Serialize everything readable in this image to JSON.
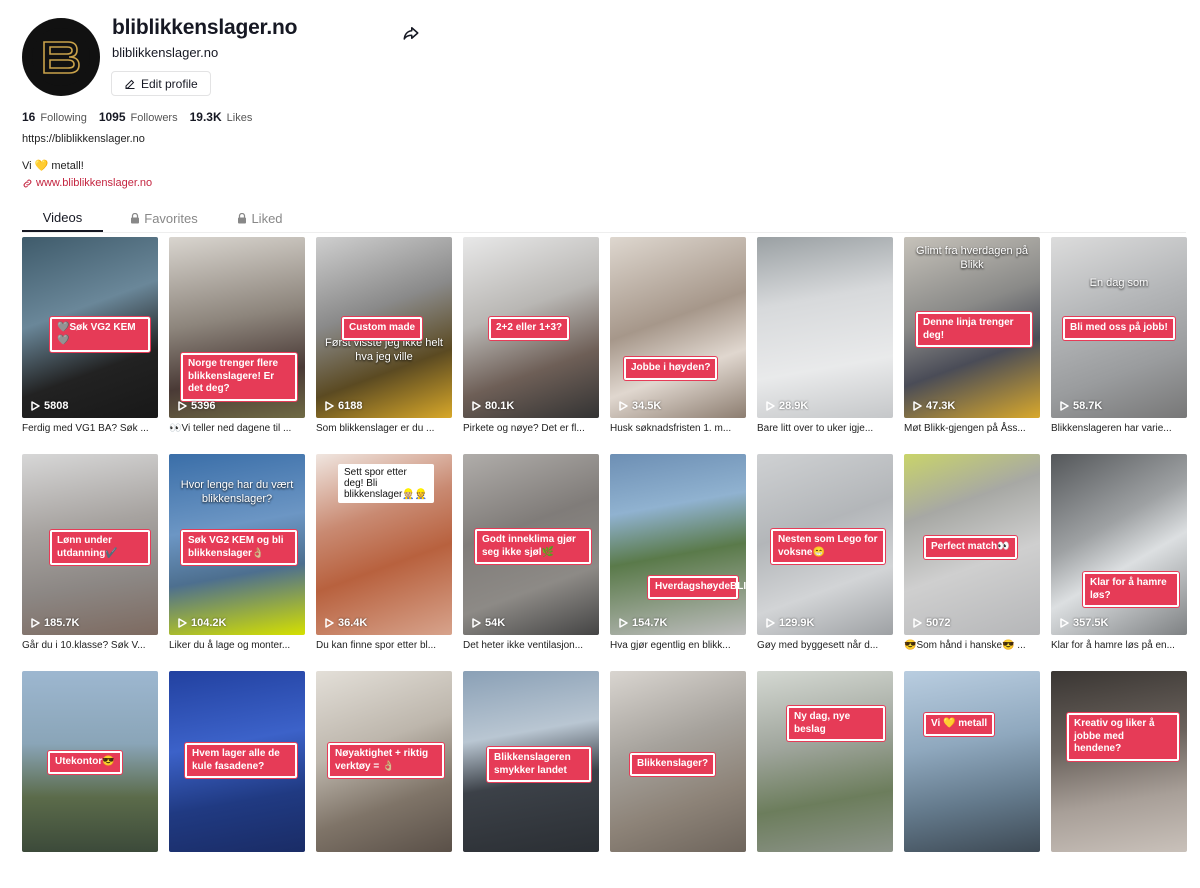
{
  "profile": {
    "username": "bliblikkenslager.no",
    "nickname": "bliblikkenslager.no",
    "edit_label": "Edit profile",
    "following_count": "16",
    "following_label": "Following",
    "followers_count": "1095",
    "followers_label": "Followers",
    "likes_count": "19.3K",
    "likes_label": "Likes",
    "url": "https://bliblikkenslager.no",
    "bio": "Vi 💛 metall!",
    "link": "www.bliblikkenslager.no"
  },
  "tabs": [
    {
      "label": "Videos"
    },
    {
      "label": "Favorites"
    },
    {
      "label": "Liked"
    }
  ],
  "colors": {
    "accent": "#fe2c55",
    "tag": "#e63b57",
    "link": "#c42540"
  },
  "videos": [
    {
      "views": "5808",
      "caption": "Ferdig med VG1 BA? Søk ...",
      "tag": "🩶Søk VG2 KEM🩶",
      "bg": "linear-gradient(160deg,#3f5b6b,#6a8799 40%,#222 70%,#181818)"
    },
    {
      "views": "5396",
      "caption": "👀Vi teller ned dagene til ...",
      "tag": "Norge trenger flere blikkenslagere! Er det deg?",
      "bg": "linear-gradient(170deg,#d9d5cf,#8d857c 45%,#4a3a36 75%,#6f6a44)"
    },
    {
      "views": "6188",
      "caption": "Som blikkenslager er du ...",
      "tag": "Custom made",
      "over": "Først visste jeg ikke helt hva jeg ville",
      "bg": "linear-gradient(160deg,#cfcfcf,#8a8a8a 40%,#5b4a22 70%,#d8a829)"
    },
    {
      "views": "80.1K",
      "caption": "Pirkete og nøye? Det er fl...",
      "tag": "2+2 eller 1+3?",
      "bg": "linear-gradient(160deg,#e8e8e8,#b9b7b4 40%,#6e5f57 70%,#333)"
    },
    {
      "views": "34.5K",
      "caption": "Husk søknadsfristen 1. m...",
      "tag": "Jobbe i høyden?",
      "bg": "linear-gradient(160deg,#ded7cf,#a6978a 45%,#e0d7cf 70%,#8c7d70)"
    },
    {
      "views": "28.9K",
      "caption": "Bare litt over to uker igje...",
      "bg": "linear-gradient(170deg,#9aa0a3,#d7d9db 35%,#e9eaeb 70%,#c5c7c9)"
    },
    {
      "views": "47.3K",
      "caption": "Møt Blikk-gjengen på Åss...",
      "tag": "Denne linja trenger deg!",
      "over": "Glimt fra hverdagen på Blikk",
      "bg": "linear-gradient(160deg,#c6c2ba,#8a8a88 40%,#4a4c57 65%,#d8a82c)"
    },
    {
      "views": "58.7K",
      "caption": "Blikkenslageren har varie...",
      "tag": "Bli med oss på jobb!",
      "over": "En dag som",
      "bg": "linear-gradient(160deg,#dcdcdc,#b4b6b8 40%,#9a9c9e 70%,#777)"
    },
    {
      "views": "185.7K",
      "caption": "Går du i 10.klasse? Søk V...",
      "tag": "Lønn under utdanning✔️",
      "bg": "linear-gradient(170deg,#d7d7d7,#a7a3a0 40%,#8c8784 70%,#7d6a60)"
    },
    {
      "views": "104.2K",
      "caption": "Liker du å lage og monter...",
      "tag": "Søk VG2 KEM og bli blikkenslager👌🏼",
      "over": "Hvor lenge har du vært blikkenslager?",
      "bg": "linear-gradient(170deg,#3a6ea8,#6c96c4 40%,#4d6f8f 65%,#d5e000)"
    },
    {
      "views": "36.4K",
      "caption": "Du kan finne spor etter bl...",
      "white": "Sett spor etter deg! Bli blikkenslager👷🏼👷",
      "bg": "linear-gradient(160deg,#f0e6e0,#c98a72 35%,#b8613e 60%,#d7a38c)"
    },
    {
      "views": "54K",
      "caption": "Det heter ikke ventilasjon...",
      "tag": "Godt inneklima gjør seg ikke sjøl🌿",
      "bg": "linear-gradient(160deg,#b0adaa,#807c79 40%,#8d8a86 70%,#444)"
    },
    {
      "views": "154.7K",
      "caption": "Hva gjør egentlig en blikk...",
      "tag": "HverdagshøydeBLIKK",
      "bg": "linear-gradient(170deg,#6d8fb4,#90b2d0 30%,#5a7a4a 55%,#bcbcbc)"
    },
    {
      "views": "129.9K",
      "caption": "Gøy med byggesett når d...",
      "tag": "Nesten som Lego for voksne😁",
      "bg": "linear-gradient(160deg,#cfd1d3,#b3b6b9 40%,#d2d4d6 70%,#9ea1a4)"
    },
    {
      "views": "5072",
      "caption": "😎Som hånd i hanske😎 ...",
      "tag": "Perfect match👀",
      "bg": "linear-gradient(160deg,#c9d46a,#a7a8a4 30%,#cfcfcf 60%,#b5b6b8)"
    },
    {
      "views": "357.5K",
      "caption": "Klar for å hamre løs på en...",
      "tag": "Klar for å hamre løs?",
      "bg": "linear-gradient(150deg,#54575a,#9ea1a3 40%,#dcdfe1 60%,#7e8183)"
    },
    {
      "views": "",
      "caption": "",
      "tag": "Utekontor😎",
      "bg": "linear-gradient(180deg,#9db7d0,#8aa5b8 40%,#5b6b4a 70%,#3c4a3a)"
    },
    {
      "views": "",
      "caption": "",
      "tag": "Hvem lager alle de kule fasadene?",
      "bg": "linear-gradient(170deg,#2241a0,#3c62c9 40%,#203a82 70%,#1a2c66)"
    },
    {
      "views": "",
      "caption": "",
      "tag": "Nøyaktighet + riktig verktøy = 👌🏼",
      "bg": "linear-gradient(160deg,#e3dfd8,#bdb6ac 40%,#7f7468 70%,#5a5048)"
    },
    {
      "views": "",
      "caption": "",
      "tag": "Blikkenslageren smykker landet",
      "bg": "linear-gradient(170deg,#8aa0b6,#b9c6d2 35%,#3c4148 60%,#2b2f34)"
    },
    {
      "views": "",
      "caption": "",
      "tag": "Blikkenslager?",
      "bg": "linear-gradient(160deg,#d9d5d0,#a6a29c 40%,#8d8378 70%,#6e655c)"
    },
    {
      "views": "",
      "caption": "",
      "tag": "Ny dag, nye beslag",
      "bg": "linear-gradient(170deg,#d4d8d2,#9fa59c 40%,#6c7d5c 70%,#8d948a)"
    },
    {
      "views": "",
      "caption": "",
      "tag": "Vi 💛 metall",
      "bg": "linear-gradient(170deg,#b9cde0,#8fa8be 40%,#647a8c 70%,#3e4a55)"
    },
    {
      "views": "",
      "caption": "",
      "tag": "Kreativ og liker å jobbe med hendene?",
      "bg": "linear-gradient(170deg,#3a3633,#6a625c 40%,#a89f98 70%,#c9c1ba)"
    }
  ]
}
